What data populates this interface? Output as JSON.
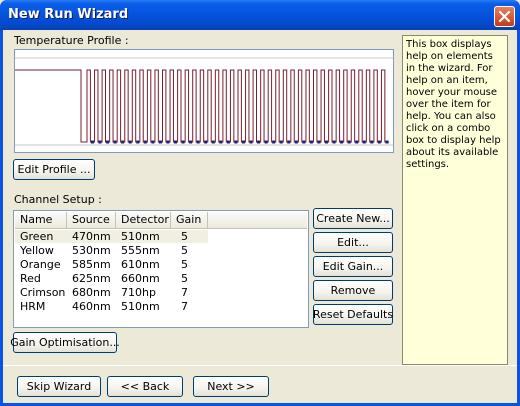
{
  "window": {
    "title": "New Run Wizard",
    "close_icon": "close-icon"
  },
  "temperature_profile": {
    "label": "Temperature Profile :",
    "edit_button": "Edit Profile ...",
    "line_color": "#7a1e2e",
    "marker_color": "#1a237e",
    "cycles": 40
  },
  "channel_setup": {
    "label": "Channel Setup :",
    "columns": [
      "Name",
      "Source",
      "Detector",
      "Gain"
    ],
    "rows": [
      {
        "name": "Green",
        "source": "470nm",
        "detector": "510nm",
        "gain": "5"
      },
      {
        "name": "Yellow",
        "source": "530nm",
        "detector": "555nm",
        "gain": "5"
      },
      {
        "name": "Orange",
        "source": "585nm",
        "detector": "610nm",
        "gain": "5"
      },
      {
        "name": "Red",
        "source": "625nm",
        "detector": "660nm",
        "gain": "5"
      },
      {
        "name": "Crimson",
        "source": "680nm",
        "detector": "710hp",
        "gain": "7"
      },
      {
        "name": "HRM",
        "source": "460nm",
        "detector": "510nm",
        "gain": "7"
      }
    ],
    "buttons": {
      "create_new": "Create New...",
      "edit": "Edit...",
      "edit_gain": "Edit Gain...",
      "remove": "Remove",
      "reset_defaults": "Reset Defaults"
    },
    "gain_optimisation": "Gain Optimisation..."
  },
  "help_text": "This box displays help on elements in the wizard. For help on an item, hover your mouse over the item for help. You can also click on a combo box to display help about its available settings.",
  "footer": {
    "skip_wizard": "Skip Wizard",
    "back": "<< Back",
    "next": "Next >>"
  }
}
